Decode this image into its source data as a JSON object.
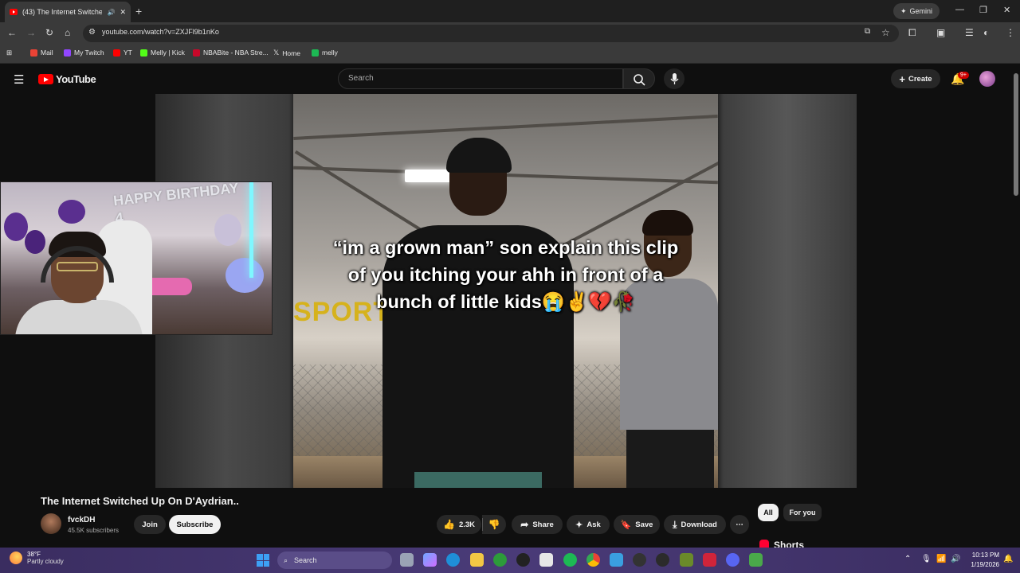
{
  "browser": {
    "tab_title": "(43) The Internet Switched",
    "url": "youtube.com/watch?v=ZXJFl9b1nKo",
    "gemini_label": "Gemini",
    "bookmarks": [
      "Mail",
      "My Twitch",
      "YT",
      "Melly | Kick",
      "NBABite - NBA Stre...",
      "Home",
      "melly"
    ]
  },
  "youtube": {
    "logo_text": "YouTube",
    "search_placeholder": "Search",
    "create_label": "Create",
    "notification_count": "9+"
  },
  "video": {
    "caption": "“im a grown man” son explain this clip of you itching your ahh in front of a bunch of little kids😭✌️💔🥀",
    "sign_text": "SPORTS",
    "facecam_text": "HAPPY BIRTHDAY 4",
    "title": "The Internet Switched Up On D'Aydrian.."
  },
  "channel": {
    "name": "fvckDH",
    "subscribers": "45.5K subscribers",
    "join_label": "Join",
    "subscribe_label": "Subscribe"
  },
  "actions": {
    "likes": "2.3K",
    "share": "Share",
    "ask": "Ask",
    "save": "Save",
    "download": "Download",
    "more": "⋯"
  },
  "sidebar": {
    "chips": [
      "All",
      "For you"
    ],
    "shorts_label": "Shorts"
  },
  "taskbar": {
    "temperature": "38°F",
    "weather": "Partly cloudy",
    "search_label": "Search",
    "time": "10:13 PM",
    "date": "1/19/2026"
  },
  "colors": {
    "youtube_red": "#ff0000",
    "page_bg": "#0f0f0f",
    "chip_bg": "#272727"
  }
}
